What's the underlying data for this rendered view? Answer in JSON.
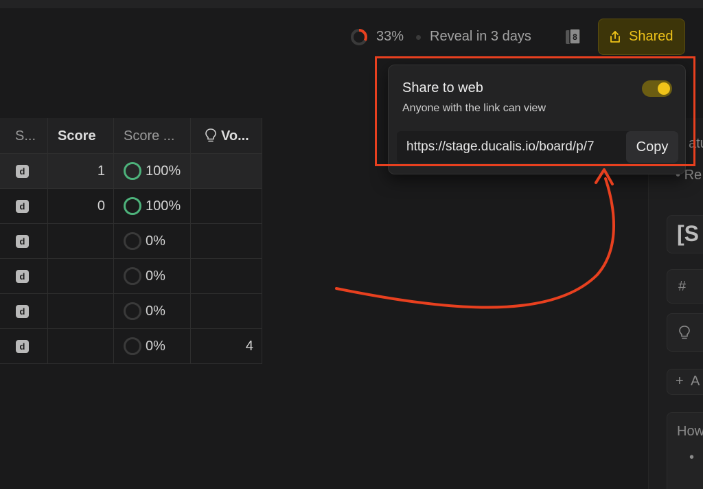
{
  "header": {
    "progress_pct": "33%",
    "progress_value": 33,
    "reveal_text": "Reveal in 3 days",
    "cards_count": "8",
    "shared_label": "Shared"
  },
  "table": {
    "columns": [
      {
        "label": "S..."
      },
      {
        "label": "Score"
      },
      {
        "label": "Score ..."
      },
      {
        "label": "Vo..."
      }
    ],
    "rows": [
      {
        "badge": "d",
        "score": "1",
        "pct": "100%",
        "votes": ""
      },
      {
        "badge": "d",
        "score": "0",
        "pct": "100%",
        "votes": ""
      },
      {
        "badge": "d",
        "score": "",
        "pct": "0%",
        "votes": ""
      },
      {
        "badge": "d",
        "score": "",
        "pct": "0%",
        "votes": ""
      },
      {
        "badge": "d",
        "score": "",
        "pct": "0%",
        "votes": ""
      },
      {
        "badge": "d",
        "score": "",
        "pct": "0%",
        "votes": "4"
      }
    ]
  },
  "popup": {
    "title": "Share to web",
    "subtitle": "Anyone with the link can view",
    "url": "https://stage.ducalis.io/board/p/7",
    "copy_label": "Copy",
    "toggle_on": true
  },
  "side_panel": {
    "partial_1": "atu",
    "partial_2": "Re",
    "heading": "[S",
    "hash": "#",
    "add": "A",
    "how": "How"
  },
  "colors": {
    "accent": "#f0c419",
    "annotation": "#e8401f",
    "success": "#4db27b"
  }
}
